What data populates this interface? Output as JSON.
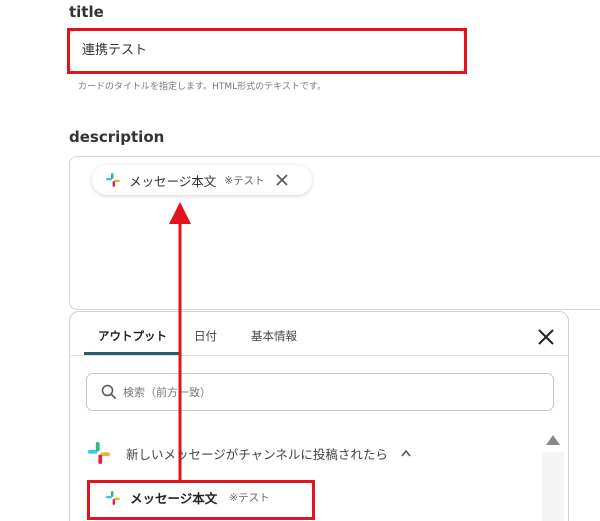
{
  "title_field": {
    "label": "title",
    "value": "連携テスト",
    "hint": "カードのタイトルを指定します。HTML形式のテキストです。"
  },
  "description_field": {
    "label": "description",
    "chip": {
      "label": "メッセージ本文",
      "sub": "※テスト",
      "icon": "slack-icon"
    }
  },
  "panel": {
    "tabs": [
      {
        "label": "アウトプット",
        "active": true
      },
      {
        "label": "日付",
        "active": false
      },
      {
        "label": "基本情報",
        "active": false
      }
    ],
    "search": {
      "placeholder": "検索（前方一致）"
    },
    "group": {
      "label": "新しいメッセージがチャンネルに投稿されたら",
      "icon": "slack-icon",
      "expanded": true
    },
    "item": {
      "label": "メッセージ本文",
      "sub": "※テスト",
      "icon": "slack-icon"
    }
  },
  "colors": {
    "highlight": "#e0141c",
    "tab_underline": "#2a5c6b",
    "slack_blue": "#36c5f0",
    "slack_green": "#2eb67d",
    "slack_yellow": "#ecb22e",
    "slack_red": "#e01e5a"
  }
}
